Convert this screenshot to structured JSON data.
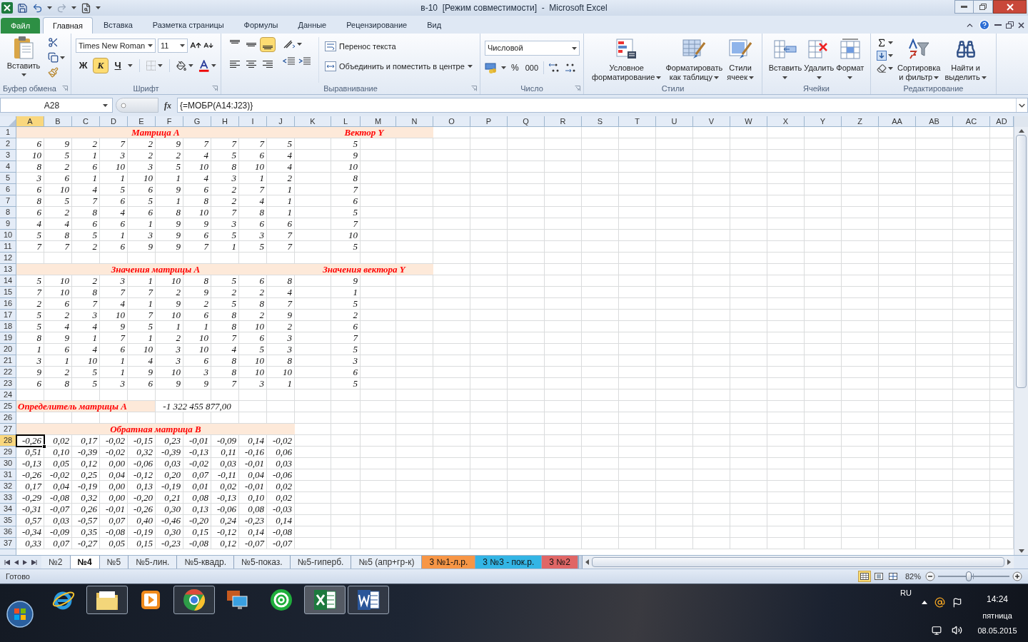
{
  "window": {
    "title": "в-10  [Режим совместимости]  -  Microsoft Excel"
  },
  "ribbon_tabs": [
    {
      "label": "Файл",
      "kind": "file",
      "selected": false
    },
    {
      "label": "Главная",
      "kind": "tab",
      "selected": true
    },
    {
      "label": "Вставка",
      "kind": "tab",
      "selected": false
    },
    {
      "label": "Разметка страницы",
      "kind": "tab",
      "selected": false
    },
    {
      "label": "Формулы",
      "kind": "tab",
      "selected": false
    },
    {
      "label": "Данные",
      "kind": "tab",
      "selected": false
    },
    {
      "label": "Рецензирование",
      "kind": "tab",
      "selected": false
    },
    {
      "label": "Вид",
      "kind": "tab",
      "selected": false
    }
  ],
  "ribbon": {
    "clipboard": {
      "label": "Буфер обмена",
      "paste": "Вставить"
    },
    "font": {
      "label": "Шрифт",
      "name": "Times New Roman",
      "size": "11",
      "styles": [
        {
          "label": "Ж",
          "kind": "bold",
          "on": false
        },
        {
          "label": "К",
          "kind": "italic",
          "on": true
        },
        {
          "label": "Ч",
          "kind": "underline",
          "on": false
        }
      ]
    },
    "alignment": {
      "label": "Выравнивание",
      "vertical": [
        {
          "kind": "top",
          "selected": false
        },
        {
          "kind": "middle",
          "selected": false
        },
        {
          "kind": "bottom",
          "selected": true
        }
      ],
      "horizontal": [
        {
          "kind": "left",
          "selected": false
        },
        {
          "kind": "center",
          "selected": false
        },
        {
          "kind": "right",
          "selected": false
        }
      ],
      "wrap": "Перенос текста",
      "merge": "Объединить и поместить в центре"
    },
    "number": {
      "label": "Число",
      "format": "Числовой",
      "percent": "%",
      "thousands": "000"
    },
    "styles": {
      "label": "Стили",
      "buttons": [
        {
          "lines": [
            "Условное",
            "форматирование"
          ],
          "kind": "conditional"
        },
        {
          "lines": [
            "Форматировать",
            "как таблицу"
          ],
          "kind": "table"
        },
        {
          "lines": [
            "Стили",
            "ячеек"
          ],
          "kind": "cell_styles"
        }
      ]
    },
    "cells": {
      "label": "Ячейки",
      "buttons": [
        {
          "label": "Вставить",
          "kind": "insert"
        },
        {
          "label": "Удалить",
          "kind": "delete"
        },
        {
          "label": "Формат",
          "kind": "format"
        }
      ]
    },
    "editing": {
      "label": "Редактирование",
      "buttons": [
        {
          "lines": [
            "Сортировка",
            "и фильтр"
          ],
          "kind": "sort"
        },
        {
          "lines": [
            "Найти и",
            "выделить"
          ],
          "kind": "find"
        }
      ]
    }
  },
  "formula_bar": {
    "name_box": "A28",
    "fx": "fx",
    "formula": "{=МОБР(A14:J23)}"
  },
  "sheet": {
    "columns": [
      {
        "label": "A",
        "selected": true
      },
      {
        "label": "B",
        "selected": false
      },
      {
        "label": "C",
        "selected": false
      },
      {
        "label": "D",
        "selected": false
      },
      {
        "label": "E",
        "selected": false
      },
      {
        "label": "F",
        "selected": false
      },
      {
        "label": "G",
        "selected": false
      },
      {
        "label": "H",
        "selected": false
      },
      {
        "label": "I",
        "selected": false
      },
      {
        "label": "J",
        "selected": false
      },
      {
        "label": "K",
        "selected": false
      },
      {
        "label": "L",
        "selected": false
      },
      {
        "label": "M",
        "selected": false
      },
      {
        "label": "N",
        "selected": false
      },
      {
        "label": "O",
        "selected": false
      },
      {
        "label": "P",
        "selected": false
      },
      {
        "label": "Q",
        "selected": false
      },
      {
        "label": "R",
        "selected": false
      },
      {
        "label": "S",
        "selected": false
      },
      {
        "label": "T",
        "selected": false
      },
      {
        "label": "U",
        "selected": false
      },
      {
        "label": "V",
        "selected": false
      },
      {
        "label": "W",
        "selected": false
      },
      {
        "label": "X",
        "selected": false
      },
      {
        "label": "Y",
        "selected": false
      },
      {
        "label": "Z",
        "selected": false
      },
      {
        "label": "AA",
        "selected": false
      },
      {
        "label": "AB",
        "selected": false
      },
      {
        "label": "AC",
        "selected": false
      },
      {
        "label": "AD",
        "selected": false
      }
    ],
    "rows": [
      {
        "number": "1",
        "selected": false,
        "merged": [
          {
            "text": "Матрица А",
            "kind": "title"
          },
          {
            "text": "Вектор Y",
            "kind": "title"
          }
        ]
      },
      {
        "number": "2",
        "selected": false,
        "values": [
          "6",
          "9",
          "2",
          "7",
          "2",
          "9",
          "7",
          "7",
          "7",
          "5"
        ],
        "vector": "5"
      },
      {
        "number": "3",
        "selected": false,
        "values": [
          "10",
          "5",
          "1",
          "3",
          "2",
          "2",
          "4",
          "5",
          "6",
          "4"
        ],
        "vector": "9"
      },
      {
        "number": "4",
        "selected": false,
        "values": [
          "8",
          "2",
          "6",
          "10",
          "3",
          "5",
          "10",
          "8",
          "10",
          "4"
        ],
        "vector": "10"
      },
      {
        "number": "5",
        "selected": false,
        "values": [
          "3",
          "6",
          "1",
          "1",
          "10",
          "1",
          "4",
          "3",
          "1",
          "2"
        ],
        "vector": "8"
      },
      {
        "number": "6",
        "selected": false,
        "values": [
          "6",
          "10",
          "4",
          "5",
          "6",
          "9",
          "6",
          "2",
          "7",
          "1"
        ],
        "vector": "7"
      },
      {
        "number": "7",
        "selected": false,
        "values": [
          "8",
          "5",
          "7",
          "6",
          "5",
          "1",
          "8",
          "2",
          "4",
          "1"
        ],
        "vector": "6"
      },
      {
        "number": "8",
        "selected": false,
        "values": [
          "6",
          "2",
          "8",
          "4",
          "6",
          "8",
          "10",
          "7",
          "8",
          "1"
        ],
        "vector": "5"
      },
      {
        "number": "9",
        "selected": false,
        "values": [
          "4",
          "4",
          "6",
          "6",
          "1",
          "9",
          "9",
          "3",
          "6",
          "6"
        ],
        "vector": "7"
      },
      {
        "number": "10",
        "selected": false,
        "values": [
          "5",
          "8",
          "5",
          "1",
          "3",
          "9",
          "6",
          "5",
          "3",
          "7"
        ],
        "vector": "10"
      },
      {
        "number": "11",
        "selected": false,
        "values": [
          "7",
          "7",
          "2",
          "6",
          "9",
          "9",
          "7",
          "1",
          "5",
          "7"
        ],
        "vector": "5"
      },
      {
        "number": "12",
        "selected": false
      },
      {
        "number": "13",
        "selected": false,
        "merged": [
          {
            "text": "Значения матрицы А",
            "kind": "title"
          },
          {
            "text": "Значения вектора Y",
            "kind": "title"
          }
        ]
      },
      {
        "number": "14",
        "selected": false,
        "values": [
          "5",
          "10",
          "2",
          "3",
          "1",
          "10",
          "8",
          "5",
          "6",
          "8"
        ],
        "vector": "9"
      },
      {
        "number": "15",
        "selected": false,
        "values": [
          "7",
          "10",
          "8",
          "7",
          "7",
          "2",
          "9",
          "2",
          "2",
          "4"
        ],
        "vector": "1"
      },
      {
        "number": "16",
        "selected": false,
        "values": [
          "2",
          "6",
          "7",
          "4",
          "1",
          "9",
          "2",
          "5",
          "8",
          "7"
        ],
        "vector": "5"
      },
      {
        "number": "17",
        "selected": false,
        "values": [
          "5",
          "2",
          "3",
          "10",
          "7",
          "10",
          "6",
          "8",
          "2",
          "9"
        ],
        "vector": "2"
      },
      {
        "number": "18",
        "selected": false,
        "values": [
          "5",
          "4",
          "4",
          "9",
          "5",
          "1",
          "1",
          "8",
          "10",
          "2"
        ],
        "vector": "6"
      },
      {
        "number": "19",
        "selected": false,
        "values": [
          "8",
          "9",
          "1",
          "7",
          "1",
          "2",
          "10",
          "7",
          "6",
          "3"
        ],
        "vector": "7"
      },
      {
        "number": "20",
        "selected": false,
        "values": [
          "1",
          "6",
          "4",
          "6",
          "10",
          "3",
          "10",
          "4",
          "5",
          "3"
        ],
        "vector": "5"
      },
      {
        "number": "21",
        "selected": false,
        "values": [
          "3",
          "1",
          "10",
          "1",
          "4",
          "3",
          "6",
          "8",
          "10",
          "8"
        ],
        "vector": "3"
      },
      {
        "number": "22",
        "selected": false,
        "values": [
          "9",
          "2",
          "5",
          "1",
          "9",
          "10",
          "3",
          "8",
          "10",
          "10"
        ],
        "vector": "6"
      },
      {
        "number": "23",
        "selected": false,
        "values": [
          "6",
          "8",
          "5",
          "3",
          "6",
          "9",
          "9",
          "7",
          "3",
          "1"
        ],
        "vector": "5"
      },
      {
        "number": "24",
        "selected": false
      },
      {
        "number": "25",
        "selected": false,
        "merged": [
          {
            "text": "Определитель матрицы А",
            "kind": "label"
          },
          {
            "text": "-1 322 455 877,00",
            "kind": "number"
          }
        ]
      },
      {
        "number": "26",
        "selected": false
      },
      {
        "number": "27",
        "selected": false,
        "merged": [
          {
            "text": "Обратная матрица B",
            "kind": "title"
          }
        ]
      },
      {
        "number": "28",
        "selected": true,
        "values": [
          "-0,26",
          "0,02",
          "0,17",
          "-0,02",
          "-0,15",
          "0,23",
          "-0,01",
          "-0,09",
          "0,14",
          "-0,02"
        ]
      },
      {
        "number": "29",
        "selected": false,
        "values": [
          "0,51",
          "0,10",
          "-0,39",
          "-0,02",
          "0,32",
          "-0,39",
          "-0,13",
          "0,11",
          "-0,16",
          "0,06"
        ]
      },
      {
        "number": "30",
        "selected": false,
        "values": [
          "-0,13",
          "0,05",
          "0,12",
          "0,00",
          "-0,06",
          "0,03",
          "-0,02",
          "0,03",
          "-0,01",
          "0,03"
        ]
      },
      {
        "number": "31",
        "selected": false,
        "values": [
          "-0,26",
          "-0,02",
          "0,25",
          "0,04",
          "-0,12",
          "0,20",
          "0,07",
          "-0,11",
          "0,04",
          "-0,06"
        ]
      },
      {
        "number": "32",
        "selected": false,
        "values": [
          "0,17",
          "0,04",
          "-0,19",
          "0,00",
          "0,13",
          "-0,19",
          "0,01",
          "0,02",
          "-0,01",
          "0,02"
        ]
      },
      {
        "number": "33",
        "selected": false,
        "values": [
          "-0,29",
          "-0,08",
          "0,32",
          "0,00",
          "-0,20",
          "0,21",
          "0,08",
          "-0,13",
          "0,10",
          "0,02"
        ]
      },
      {
        "number": "34",
        "selected": false,
        "values": [
          "-0,31",
          "-0,07",
          "0,26",
          "-0,01",
          "-0,26",
          "0,30",
          "0,13",
          "-0,06",
          "0,08",
          "-0,03"
        ]
      },
      {
        "number": "35",
        "selected": false,
        "values": [
          "0,57",
          "0,03",
          "-0,57",
          "0,07",
          "0,40",
          "-0,46",
          "-0,20",
          "0,24",
          "-0,23",
          "0,14"
        ]
      },
      {
        "number": "36",
        "selected": false,
        "values": [
          "-0,34",
          "-0,09",
          "0,35",
          "-0,08",
          "-0,19",
          "0,30",
          "0,15",
          "-0,12",
          "0,14",
          "-0,08"
        ]
      },
      {
        "number": "37",
        "selected": false,
        "values": [
          "0,33",
          "0,07",
          "-0,27",
          "0,05",
          "0,15",
          "-0,23",
          "-0,08",
          "0,12",
          "-0,07",
          "-0,07"
        ]
      }
    ]
  },
  "sheet_tabs": [
    {
      "label": "№2",
      "selected": false
    },
    {
      "label": "№4",
      "selected": true
    },
    {
      "label": "№5",
      "selected": false
    },
    {
      "label": "№5-лин.",
      "selected": false
    },
    {
      "label": "№5-квадр.",
      "selected": false
    },
    {
      "label": "№5-показ.",
      "selected": false
    },
    {
      "label": "№5-гиперб.",
      "selected": false
    },
    {
      "label": "№5 (апр+гр-к)",
      "selected": false
    },
    {
      "label": "3 №1-л.р.",
      "selected": false,
      "color": "#f79646"
    },
    {
      "label": "3 №3 - пок.р.",
      "selected": false,
      "color": "#33b5e5"
    },
    {
      "label": "3 №2",
      "selected": false,
      "color": "#e06666"
    }
  ],
  "status_bar": {
    "status": "Готово",
    "views": [
      {
        "kind": "normal",
        "selected": true
      },
      {
        "kind": "layout",
        "selected": false
      },
      {
        "kind": "page_break",
        "selected": false
      }
    ],
    "zoom": "82%",
    "zoom_slider": {
      "level": 0.43
    }
  },
  "taskbar": {
    "apps": [
      {
        "kind": "ie",
        "running": false,
        "selected": false
      },
      {
        "kind": "explorer",
        "running": true,
        "selected": false
      },
      {
        "kind": "player",
        "running": false,
        "selected": false
      },
      {
        "kind": "chrome",
        "running": true,
        "selected": false
      },
      {
        "kind": "remote",
        "running": false,
        "selected": false
      },
      {
        "kind": "mail",
        "running": false,
        "selected": false
      },
      {
        "kind": "excel",
        "running": true,
        "selected": true
      },
      {
        "kind": "word",
        "running": true,
        "selected": false
      }
    ],
    "language": "RU",
    "time": "14:24",
    "weekday": "пятница",
    "date": "08.05.2015"
  }
}
